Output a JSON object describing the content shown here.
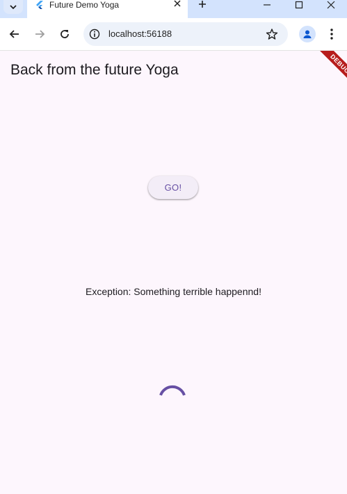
{
  "browser": {
    "tab_title": "Future Demo Yoga",
    "url": "localhost:56188"
  },
  "app": {
    "title": "Back from the future Yoga",
    "debug_banner": "DEBUG",
    "go_button_label": "GO!",
    "exception_text": "Exception: Something terrible happennd!",
    "spinner_color": "#6750a4"
  }
}
